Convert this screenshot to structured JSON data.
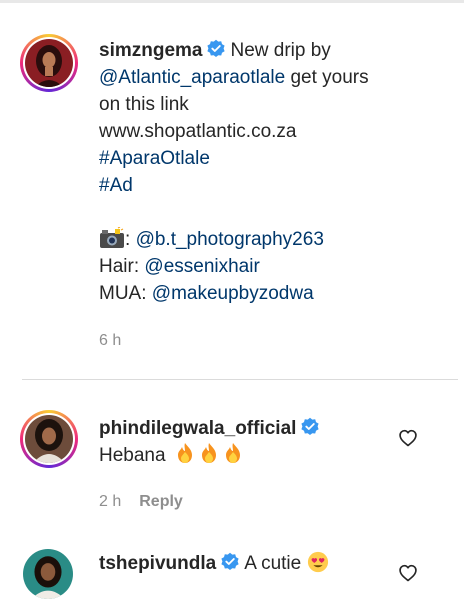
{
  "post": {
    "username": "simzngema",
    "text_start": "New drip by",
    "mention_brand": "@Atlantic_aparaotlale",
    "text_mid": "get yours",
    "text_line3": "on this link",
    "url": "www.shopatlantic.co.za",
    "hashtag1": "#AparaOtlale",
    "hashtag2": "#Ad",
    "photo_label": ":",
    "photo_credit": "@b.t_photography263",
    "hair_label": "Hair:",
    "hair_credit": "@essenixhair",
    "mua_label": "MUA:",
    "mua_credit": "@makeupbyzodwa",
    "time": "6 h"
  },
  "comments": [
    {
      "username": "phindilegwala_official",
      "text": "Hebana",
      "time": "2 h",
      "reply_label": "Reply"
    },
    {
      "username": "tshepivundla",
      "text": "A cutie"
    }
  ],
  "colors": {
    "link": "#00376b",
    "verified": "#3897f0",
    "meta": "#8e8e8e"
  },
  "icons": [
    "verified-badge-icon",
    "camera-emoji-icon",
    "fire-emoji-icon",
    "heart-eyes-emoji-icon",
    "heart-outline-icon"
  ]
}
